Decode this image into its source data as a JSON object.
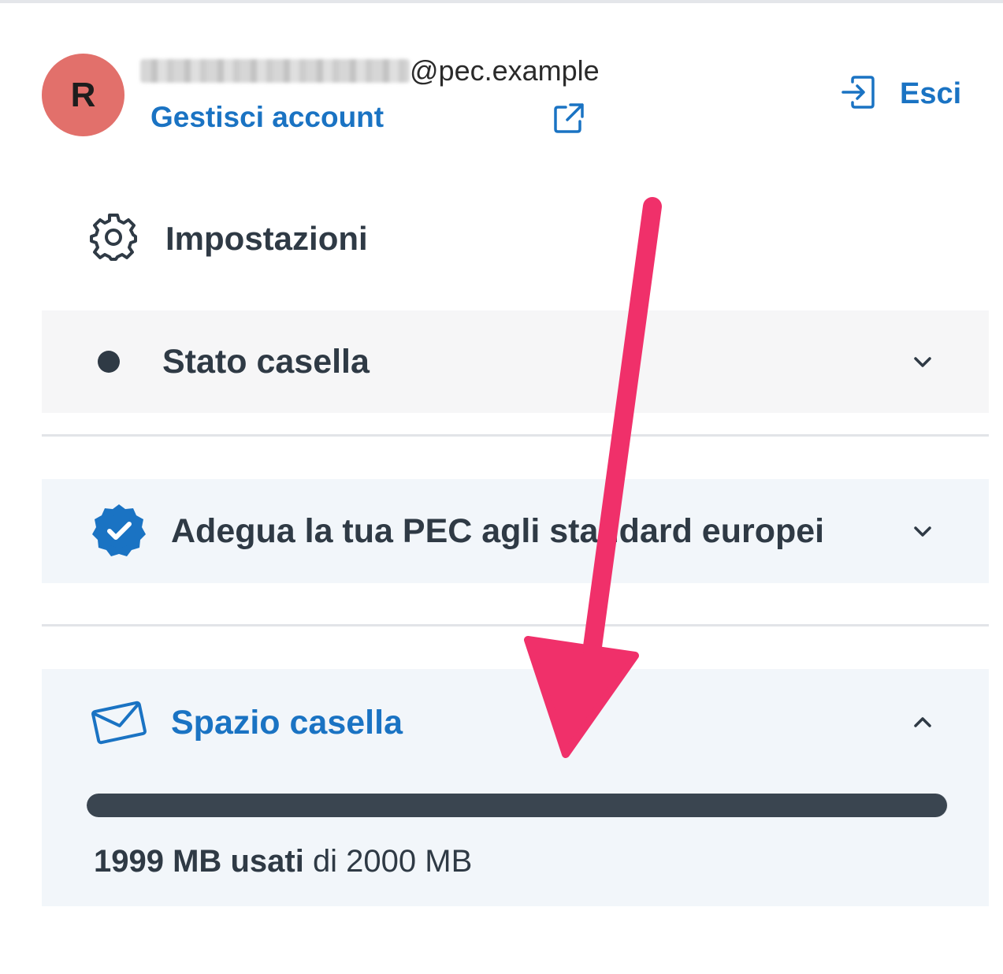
{
  "header": {
    "avatar_initial": "R",
    "email_domain": "@pec.example",
    "manage_account_label": "Gestisci account",
    "logout_label": "Esci"
  },
  "settings": {
    "label": "Impostazioni",
    "icon": "gear-icon"
  },
  "sections": {
    "stato": {
      "label": "Stato casella",
      "expanded": false
    },
    "adegua": {
      "label": "Adegua la tua PEC agli standard europei",
      "expanded": false
    },
    "spazio": {
      "label": "Spazio casella",
      "expanded": true,
      "used_value": "1999",
      "used_unit": "MB",
      "used_word": "usati",
      "total_text": "di 2000 MB",
      "used_fraction": 0.9995
    }
  },
  "colors": {
    "accent": "#1a73c3",
    "avatar": "#e2706b",
    "annotation_arrow": "#f0306a",
    "progress_fill": "#3a4550"
  }
}
